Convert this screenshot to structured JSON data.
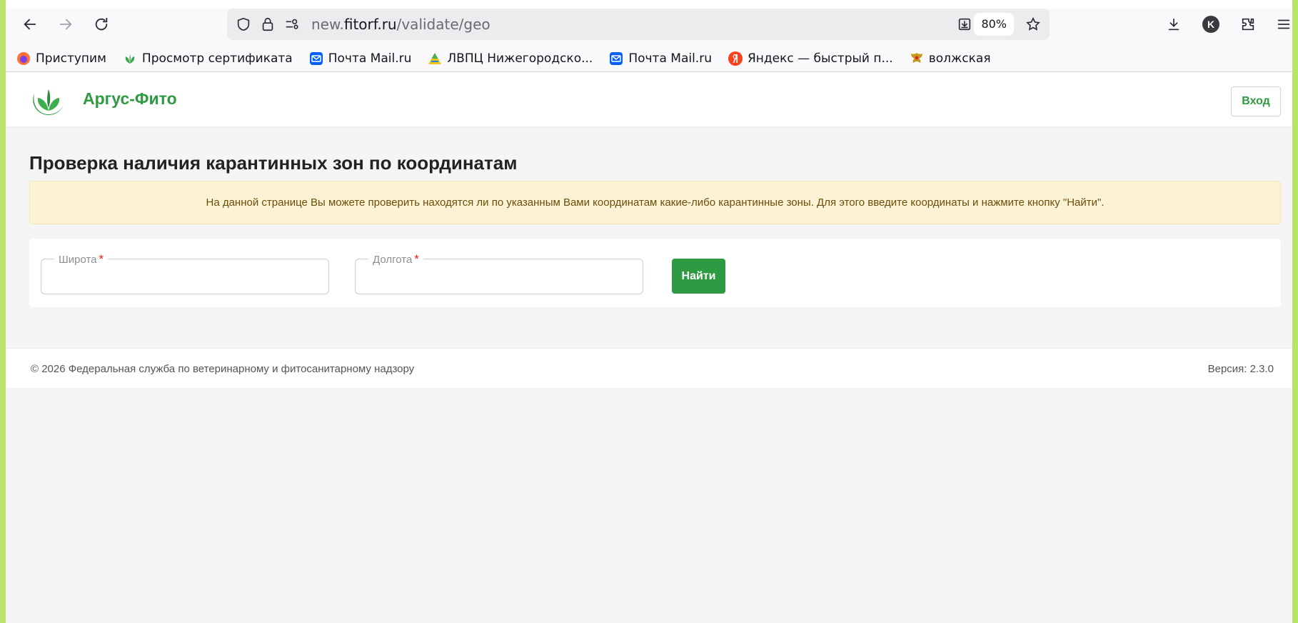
{
  "browser": {
    "url_prefix": "new.",
    "url_domain": "fitorf.ru",
    "url_path": "/validate/geo",
    "zoom": "80%",
    "account_initial": "K"
  },
  "bookmarks": [
    {
      "label": "Приступим",
      "icon": "firefox-icon"
    },
    {
      "label": "Просмотр сертификата",
      "icon": "argus-leaf-icon"
    },
    {
      "label": "Почта Mail.ru",
      "icon": "mail-icon"
    },
    {
      "label": "ЛВПЦ Нижегородско...",
      "icon": "pyramid-icon"
    },
    {
      "label": "Почта Mail.ru",
      "icon": "mail-icon"
    },
    {
      "label": "Яндекс — быстрый п...",
      "icon": "yandex-icon"
    },
    {
      "label": "волжская",
      "icon": "emblem-icon"
    }
  ],
  "header": {
    "brand": "Аргус-Фито",
    "login_label": "Вход"
  },
  "main": {
    "title": "Проверка наличия карантинных зон по координатам",
    "alert": "На данной странице Вы можете проверить находятся ли по указанным Вами координатам какие-либо карантинные зоны. Для этого введите координаты и нажмите кнопку \"Найти\".",
    "latitude_label": "Широта",
    "longitude_label": "Долгота",
    "required_mark": "*",
    "latitude_value": "",
    "longitude_value": "",
    "find_label": "Найти"
  },
  "footer": {
    "copyright": "© 2026 Федеральная служба по ветеринарному и фитосанитарному надзору",
    "version": "Версия: 2.3.0"
  },
  "colors": {
    "brand_green": "#2e9a42",
    "alert_bg": "#fcf3d4",
    "required_red": "#e01e1e"
  }
}
